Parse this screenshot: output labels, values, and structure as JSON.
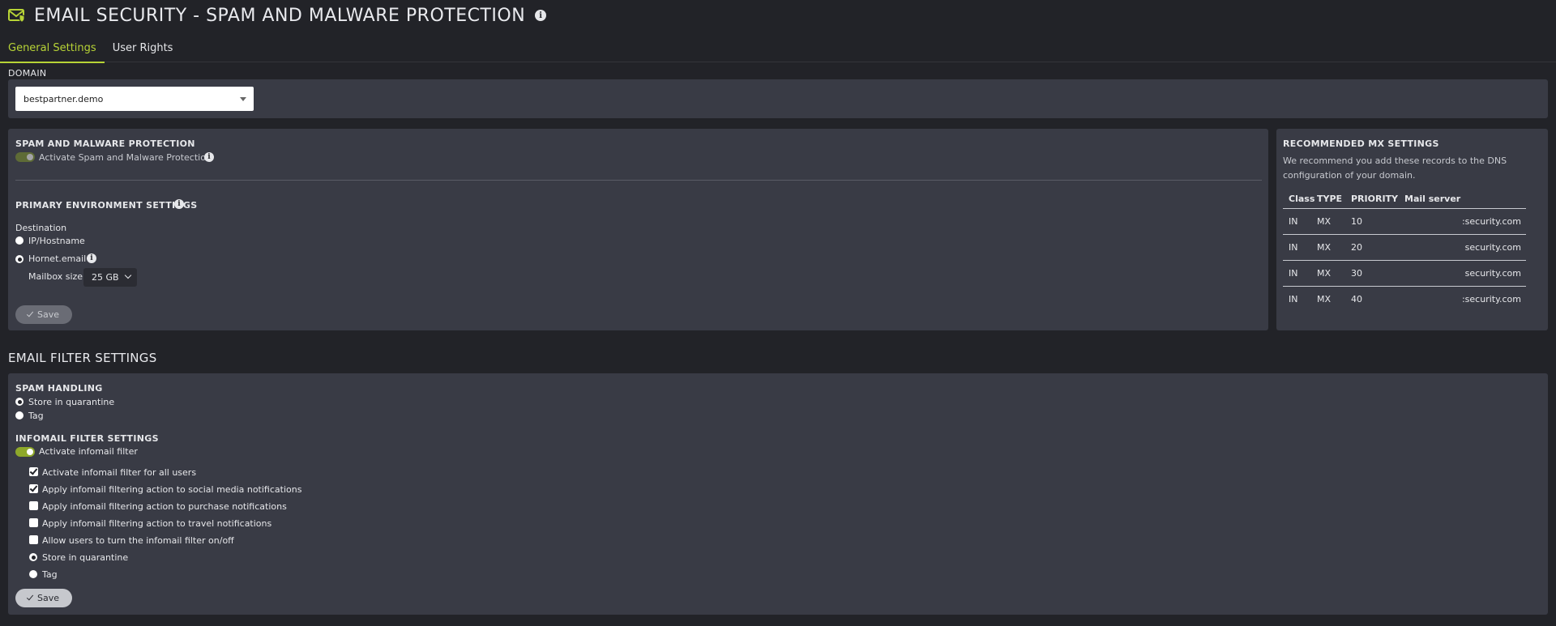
{
  "header": {
    "title": "EMAIL SECURITY - SPAM AND MALWARE PROTECTION",
    "icon": "email-shield-icon",
    "info_icon": "info-icon"
  },
  "colors": {
    "accent": "#b7d336",
    "panel": "#393b45",
    "background": "#222328"
  },
  "tabs": [
    {
      "label": "General Settings",
      "active": true
    },
    {
      "label": "User Rights",
      "active": false
    }
  ],
  "domain": {
    "label": "DOMAIN",
    "selected": "bestpartner.demo"
  },
  "spam_protection": {
    "heading": "SPAM AND MALWARE PROTECTION",
    "toggle_label": "Activate Spam and Malware Protection",
    "toggle_on": true,
    "primary_heading": "PRIMARY ENVIRONMENT SETTINGS",
    "destination_label": "Destination",
    "options": [
      {
        "label": "IP/Hostname",
        "selected": false
      },
      {
        "label": "Hornet.email",
        "selected": true
      }
    ],
    "mailbox_size_label": "Mailbox size",
    "mailbox_size_value": "25 GB",
    "save_label": "Save"
  },
  "mx": {
    "heading": "RECOMMENDED MX SETTINGS",
    "description_line1": "We recommend you add these records to the DNS",
    "description_line2": "configuration of your domain.",
    "columns": [
      "Class",
      "TYPE",
      "PRIORITY",
      "Mail server"
    ],
    "rows": [
      [
        "IN",
        "MX",
        "10",
        ":security.com"
      ],
      [
        "IN",
        "MX",
        "20",
        "security.com"
      ],
      [
        "IN",
        "MX",
        "30",
        "security.com"
      ],
      [
        "IN",
        "MX",
        "40",
        ":security.com"
      ]
    ]
  },
  "email_filter": {
    "heading": "EMAIL FILTER SETTINGS",
    "spam_handling_heading": "SPAM HANDLING",
    "spam_options": [
      {
        "label": "Store in quarantine",
        "selected": true
      },
      {
        "label": "Tag",
        "selected": false
      }
    ],
    "infomail_heading": "INFOMAIL FILTER SETTINGS",
    "infomail_toggle_label": "Activate infomail filter",
    "infomail_toggle_on": true,
    "checkboxes": [
      {
        "label": "Activate infomail filter for all users",
        "checked": true
      },
      {
        "label": "Apply infomail filtering action to social media notifications",
        "checked": true
      },
      {
        "label": "Apply infomail filtering action to purchase notifications",
        "checked": false
      },
      {
        "label": "Apply infomail filtering action to travel notifications",
        "checked": false
      },
      {
        "label": "Allow users to turn the infomail filter on/off",
        "checked": false
      }
    ],
    "infomail_options": [
      {
        "label": "Store in quarantine",
        "selected": true
      },
      {
        "label": "Tag",
        "selected": false
      }
    ],
    "save_label": "Save"
  }
}
